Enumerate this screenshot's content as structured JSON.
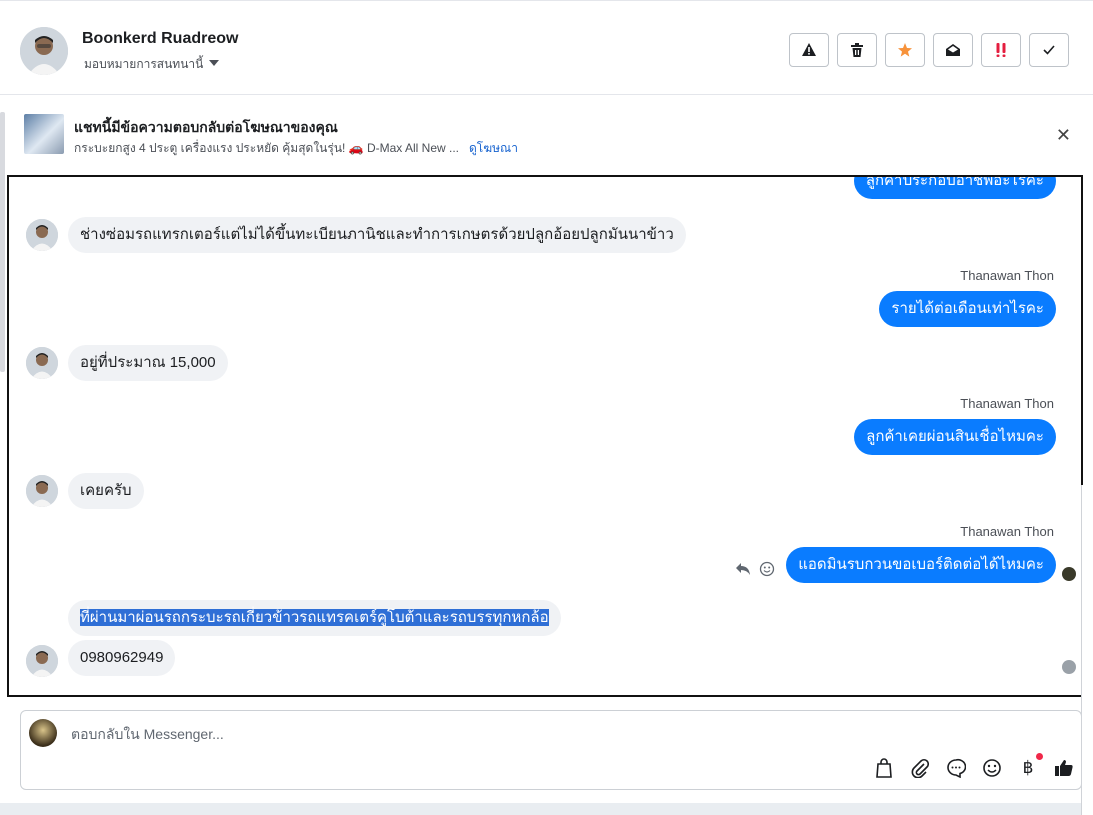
{
  "contact": {
    "name": "Boonkerd Ruadreow",
    "assign_label": "มอบหมายการสนทนานี้"
  },
  "header_actions": [
    {
      "name": "spam-button",
      "icon": "warning-icon"
    },
    {
      "name": "delete-button",
      "icon": "trash-icon"
    },
    {
      "name": "star-button",
      "icon": "star-icon",
      "color": "#f7923a"
    },
    {
      "name": "mark-unread-button",
      "icon": "envelope-open-icon"
    },
    {
      "name": "follow-up-button",
      "icon": "exclamation-icon",
      "color": "#e41e3f"
    },
    {
      "name": "done-button",
      "icon": "check-icon"
    }
  ],
  "ad_banner": {
    "title": "แชทนี้มีข้อความตอบกลับต่อโฆษณาของคุณ",
    "subtitle": "กระบะยกสูง 4 ประตู เครื่องแรง ประหยัด คุ้มสุดในรุ่น! 🚗 D-Max All New ...",
    "link": "ดูโฆษณา"
  },
  "messages": [
    {
      "side": "out",
      "text": "ลูกค้าประกอบอาชีพอะไรคะ"
    },
    {
      "side": "in",
      "text": "ช่างซ่อมรถแทรกเตอร์แต่ไม่ได้ขึ้นทะเบียนภานิชและทำการเกษตรด้วยปลูกอ้อยปลูกมันนาข้าว"
    },
    {
      "side": "out",
      "sender": "Thanawan Thon",
      "text": "รายได้ต่อเดือนเท่าไรคะ"
    },
    {
      "side": "in",
      "text": "อยู่ที่ประมาณ 15,000"
    },
    {
      "side": "out",
      "sender": "Thanawan Thon",
      "text": "ลูกค้าเคยผ่อนสินเชื่อไหมคะ"
    },
    {
      "side": "in",
      "text": "เคยครับ"
    },
    {
      "side": "out",
      "sender": "Thanawan Thon",
      "text": "แอดมินรบกวนขอเบอร์ติดต่อได้ไหมคะ"
    },
    {
      "side": "in",
      "text": "ที่ผ่านมาผ่อนรถกระบะรถเกี่ยวข้าวรถแทรคเตร์คูโบต้าและรถบรรทุกหกล้อ",
      "selected": true
    },
    {
      "side": "in",
      "text": "0980962949"
    }
  ],
  "composer": {
    "placeholder": "ตอบกลับใน Messenger..."
  }
}
